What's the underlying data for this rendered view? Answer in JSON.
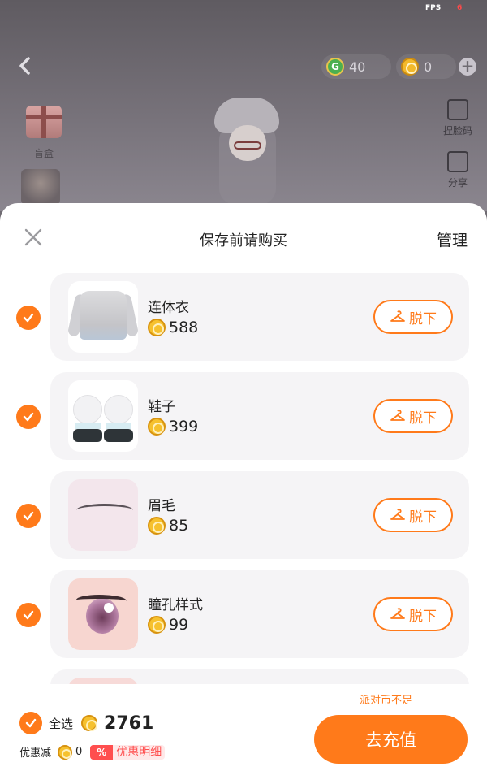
{
  "status": {
    "fps_label": "FPS",
    "fps_value": "6"
  },
  "top_bar": {
    "green_currency": "40",
    "coin_currency": "0"
  },
  "scene": {
    "gift_label": "盲盒",
    "side_buttons": [
      {
        "label": "捏脸码"
      },
      {
        "label": "分享"
      }
    ]
  },
  "sheet": {
    "title": "保存前请购买",
    "manage_label": "管理",
    "remove_label": "脱下",
    "items": [
      {
        "name": "连体衣",
        "price": "588",
        "checked": true
      },
      {
        "name": "鞋子",
        "price": "399",
        "checked": true
      },
      {
        "name": "眉毛",
        "price": "85",
        "checked": true
      },
      {
        "name": "瞳孔样式",
        "price": "99",
        "checked": true
      }
    ]
  },
  "footer": {
    "insufficient_note": "派对币不足",
    "select_all_label": "全选",
    "total": "2761",
    "discount_label": "优惠减",
    "discount_value": "0",
    "percent_badge": "%",
    "discount_detail_label": "优惠明细",
    "recharge_label": "去充值"
  },
  "colors": {
    "accent": "#ff7a1a",
    "discount_red": "#ff4f4f",
    "coin_gold": "#f6c12e",
    "green_currency": "#4caf50"
  },
  "icons": [
    "back-arrow-icon",
    "g-currency-icon",
    "coin-icon",
    "plus-icon",
    "gift-box-icon",
    "face-code-icon",
    "share-icon",
    "close-icon",
    "check-icon",
    "hanger-icon"
  ]
}
